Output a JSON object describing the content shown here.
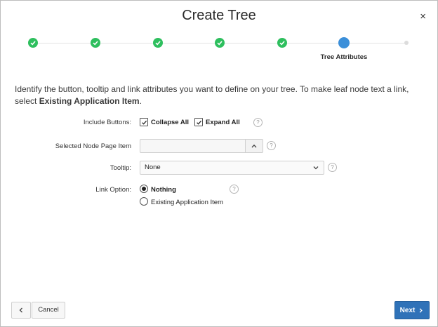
{
  "dialog": {
    "title": "Create Tree",
    "close_symbol": "×"
  },
  "wizard": {
    "steps": [
      {
        "state": "complete",
        "label": ""
      },
      {
        "state": "complete",
        "label": ""
      },
      {
        "state": "complete",
        "label": ""
      },
      {
        "state": "complete",
        "label": ""
      },
      {
        "state": "complete",
        "label": ""
      },
      {
        "state": "current",
        "label": "Tree Attributes"
      },
      {
        "state": "future",
        "label": ""
      }
    ],
    "colors": {
      "complete": "#2ebf5e",
      "current": "#3b8fd9",
      "future": "#dcdcdc"
    }
  },
  "intro": {
    "text": "Identify the button, tooltip and link attributes you want to define on your tree. To make leaf node text a link, select ",
    "bold": "Existing Application Item",
    "end": "."
  },
  "form": {
    "include_buttons": {
      "label": "Include Buttons:",
      "options": [
        {
          "label": "Collapse All",
          "checked": true
        },
        {
          "label": "Expand All",
          "checked": true
        }
      ]
    },
    "selected_node": {
      "label": "Selected Node Page Item",
      "value": ""
    },
    "tooltip": {
      "label": "Tooltip:",
      "value": "None"
    },
    "link_option": {
      "label": "Link Option:",
      "options": [
        {
          "label": "Nothing",
          "selected": true
        },
        {
          "label": "Existing Application Item",
          "selected": false
        }
      ]
    },
    "help_symbol": "?"
  },
  "footer": {
    "cancel_label": "Cancel",
    "next_label": "Next",
    "accent": "#2f72b8"
  }
}
